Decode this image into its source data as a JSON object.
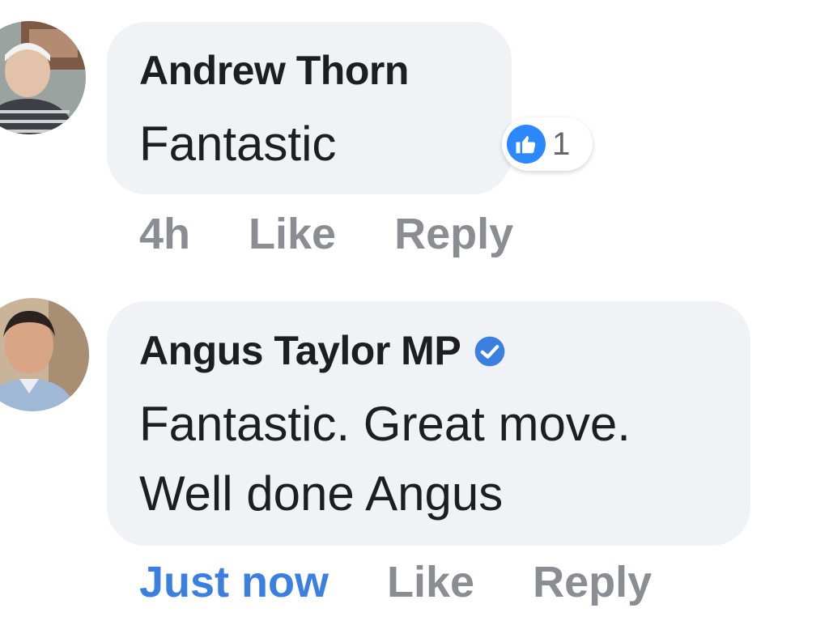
{
  "comments": [
    {
      "author": "Andrew Thorn",
      "text_lines": [
        "Fantastic"
      ],
      "timestamp": "4h",
      "like_label": "Like",
      "reply_label": "Reply",
      "reaction": {
        "icon": "thumbs-up-icon",
        "count": "1",
        "color": "#2d88ff"
      }
    },
    {
      "author": "Angus Taylor MP",
      "verified": true,
      "verified_icon": "verified-badge-icon",
      "text_lines": [
        "Fantastic. Great move.",
        "Well done Angus"
      ],
      "timestamp": "Just now",
      "timestamp_color": "#3b7fe0",
      "like_label": "Like",
      "reply_label": "Reply"
    }
  ]
}
